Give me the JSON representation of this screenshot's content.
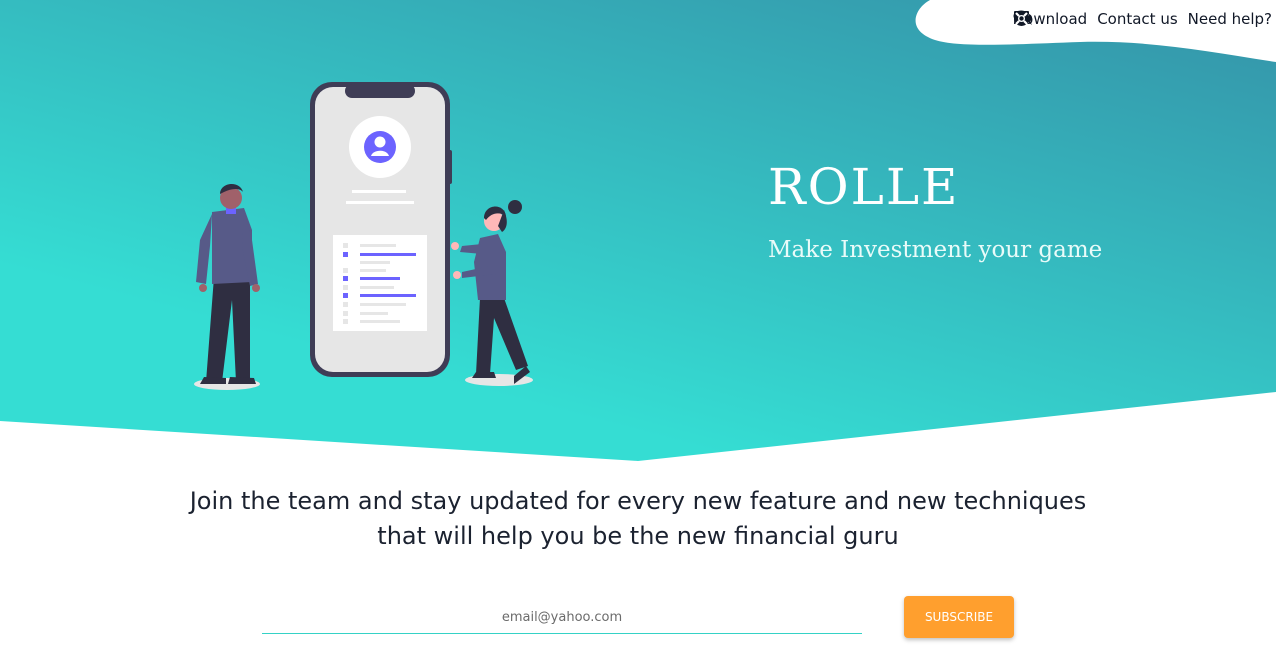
{
  "nav": {
    "items": [
      {
        "label": "Download",
        "icon": "download-box-icon"
      },
      {
        "label": "Contact us",
        "icon": "chat-bubbles-icon"
      },
      {
        "label": "Need help?",
        "icon": "lifebuoy-icon"
      }
    ]
  },
  "brand": {
    "title": "ROLLE",
    "tagline": "Make Investment your game"
  },
  "intro": {
    "line1": "Join the team and stay updated for every new feature and new techniques",
    "line2": "that will help you be the new financial guru"
  },
  "signup": {
    "email_placeholder": "email@yahoo.com",
    "email_value": "",
    "subscribe_label": "SUBSCRIBE"
  },
  "colors": {
    "hero_start": "#35ddd3",
    "hero_end": "#3391a6",
    "accent_purple": "#6c63ff",
    "button": "#ff9f2e"
  }
}
